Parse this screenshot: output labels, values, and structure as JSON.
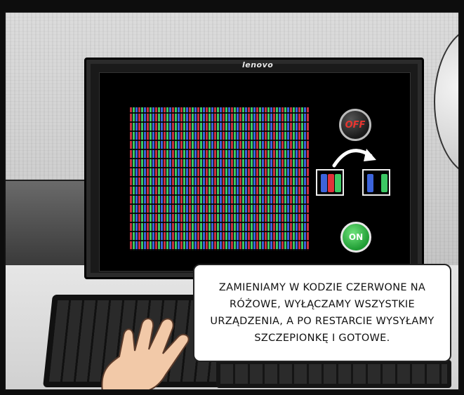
{
  "monitor": {
    "brand": "lenovo",
    "off_label": "OFF",
    "on_label": "ON"
  },
  "colors": {
    "red_subpixel": "#c83241",
    "green_subpixel": "#3cc864",
    "blue_subpixel": "#3c64dc",
    "off_text": "#e8352f",
    "on_button": "#2fb546"
  },
  "icons": {
    "off_button": "power-off-icon",
    "on_button": "power-on-icon",
    "swap_arrow": "curved-arrow-icon"
  },
  "speech_bubble": {
    "lines": [
      "ZAMIENIAMY W KODZIE CZERWONE NA",
      "RÓŻOWE, WYŁĄCZAMY WSZYSTKIE",
      "URZĄDZENIA, A PO RESTARCIE WYSYŁAMY",
      "SZCZEPIONKĘ I GOTOWE."
    ]
  }
}
